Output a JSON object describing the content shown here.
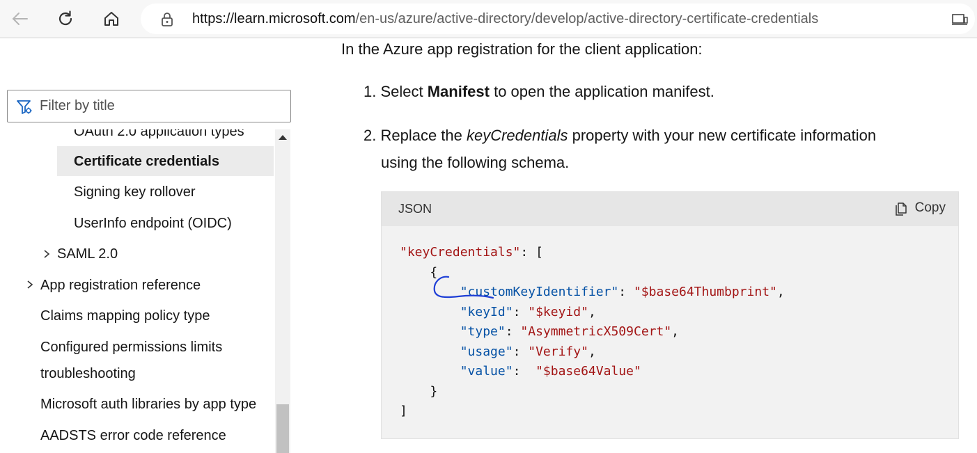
{
  "browser": {
    "url_host": "https://learn.microsoft.com",
    "url_path": "/en-us/azure/active-directory/develop/active-directory-certificate-credentials"
  },
  "sidebar": {
    "filter_placeholder": "Filter by title",
    "items": [
      {
        "label": "OAuth 2.0 application types"
      },
      {
        "label": "Certificate credentials"
      },
      {
        "label": "Signing key rollover"
      },
      {
        "label": "UserInfo endpoint (OIDC)"
      },
      {
        "label": "SAML 2.0"
      },
      {
        "label": "App registration reference"
      },
      {
        "label": "Claims mapping policy type"
      },
      {
        "label": "Configured permissions limits"
      },
      {
        "label": "troubleshooting"
      },
      {
        "label": "Microsoft auth libraries by app type"
      },
      {
        "label": "AADSTS error code reference"
      }
    ]
  },
  "main": {
    "intro": "In the Azure app registration for the client application:",
    "step1_prefix": "1. Select ",
    "step1_bold": "Manifest",
    "step1_suffix": " to open the application manifest.",
    "step2_prefix": "2. Replace the ",
    "step2_italic": "keyCredentials",
    "step2_suffix": " property with your new certificate information",
    "step2_line2": "using the following schema.",
    "code": {
      "language": "JSON",
      "copy_label": "Copy",
      "lines": {
        "l1_key": "\"keyCredentials\"",
        "l1_rest": ": [",
        "l2": "{",
        "l3_key": "\"customKeyIdentifier\"",
        "l3_val": "\"$base64Thumbprint\"",
        "l4_key": "\"keyId\"",
        "l4_val": "\"$keyid\"",
        "l5_key": "\"type\"",
        "l5_val": "\"AsymmetricX509Cert\"",
        "l6_key": "\"usage\"",
        "l6_val": "\"Verify\"",
        "l7_key": "\"value\"",
        "l7_val": "\"$base64Value\"",
        "l8": "}",
        "l9": "]"
      }
    }
  },
  "colors": {
    "code_string": "#a31515",
    "code_key": "#0451a5",
    "annotation": "#1f3fd6"
  }
}
